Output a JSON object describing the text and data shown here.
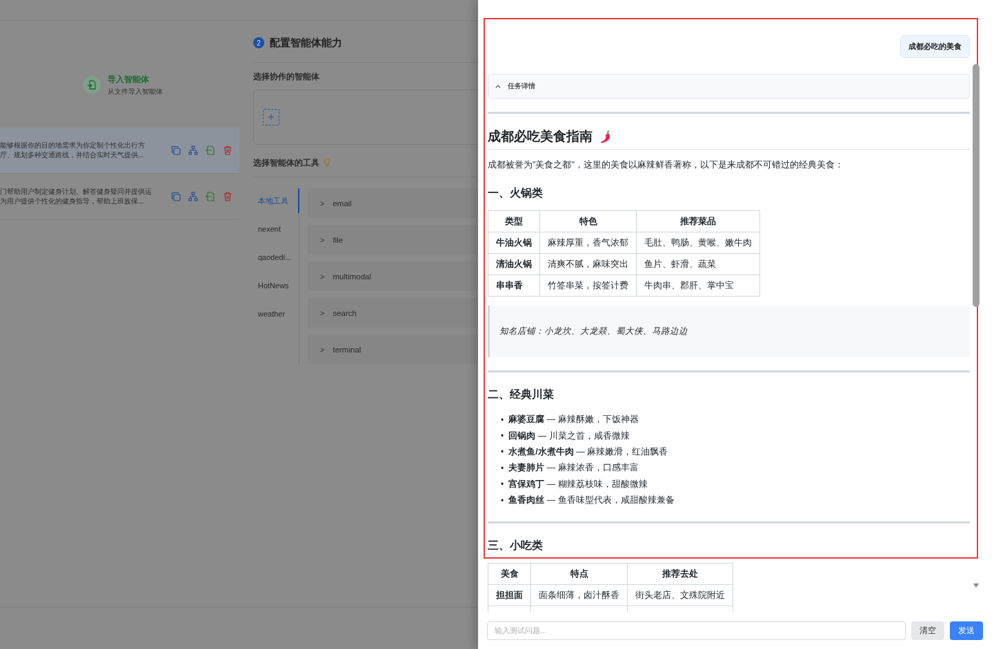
{
  "background_page": {
    "import_card": {
      "title": "导入智能体",
      "subtitle": "从文件导入智能体"
    },
    "agents": [
      {
        "selected": true,
        "lines": [
          "能够根据你的目的地需求为你定制个性化出行方",
          "厅、规划多种交通路线，并结合实时天气提供..."
        ]
      },
      {
        "selected": false,
        "lines": [
          "门帮助用户制定健身计划、解答健身疑问并提供运",
          "为用户提供个性化的健身指导，帮助上班族保..."
        ]
      }
    ],
    "step": {
      "number": "2",
      "title": "配置智能体能力"
    },
    "collab_label": "选择协作的智能体",
    "add_button": "+",
    "tools_label": "选择智能体的工具",
    "tool_sources": [
      {
        "label": "本地工具",
        "selected": true
      },
      {
        "label": "nexent",
        "selected": false
      },
      {
        "label": "qaodedi...",
        "selected": false
      },
      {
        "label": "HotNews",
        "selected": false
      },
      {
        "label": "weather",
        "selected": false
      }
    ],
    "tools": [
      {
        "name": "email",
        "expander": ">"
      },
      {
        "name": "file",
        "expander": ">"
      },
      {
        "name": "multimodal",
        "expander": ">"
      },
      {
        "name": "search",
        "expander": ">"
      },
      {
        "name": "terminal",
        "expander": ">"
      }
    ]
  },
  "drawer": {
    "user_message": "成都必吃的美食",
    "task_details": {
      "label": "任务详情"
    },
    "answer": [
      {
        "kind": "hr"
      },
      {
        "kind": "h1",
        "text": "成都必吃美食指南"
      },
      {
        "kind": "p",
        "text": "成都被誉为\"美食之都\"，这里的美食以麻辣鲜香著称，以下是来成都不可错过的经典美食："
      },
      {
        "kind": "h2",
        "text": "一、火锅类"
      },
      {
        "kind": "table",
        "columns": [
          "类型",
          "特色",
          "推荐菜品"
        ],
        "rows": [
          [
            "牛油火锅",
            "麻辣厚重，香气浓郁",
            "毛肚、鸭肠、黄喉、嫩牛肉"
          ],
          [
            "清油火锅",
            "清爽不腻，麻味突出",
            "鱼片、虾滑、蔬菜"
          ],
          [
            "串串香",
            "竹签串菜，按签计费",
            "牛肉串、郡肝、掌中宝"
          ]
        ]
      },
      {
        "kind": "quote",
        "text": "知名店铺：小龙坎、大龙燚、蜀大侠、马路边边"
      },
      {
        "kind": "hr"
      },
      {
        "kind": "h2",
        "text": "二、经典川菜"
      },
      {
        "kind": "list",
        "marker": "•",
        "items": [
          "**麻婆豆腐** — 麻辣酥嫩，下饭神器",
          "**回锅肉** — 川菜之首，咸香微辣",
          "**水煮鱼/水煮牛肉** — 麻辣嫩滑，红油飘香",
          "**夫妻肺片** — 麻辣浓香，口感丰富",
          "**宫保鸡丁** — 糊辣荔枝味，甜酸微辣",
          "**鱼香肉丝** — 鱼香味型代表，咸甜酸辣兼备"
        ]
      },
      {
        "kind": "hr"
      },
      {
        "kind": "h2",
        "text": "三、小吃类"
      },
      {
        "kind": "table",
        "columns": [
          "美食",
          "特点",
          "推荐去处"
        ],
        "rows": [
          [
            "担担面",
            "面条细薄，卤汁酥香",
            "街头老店、文殊院附近"
          ]
        ],
        "cut_row": true
      }
    ],
    "input": {
      "placeholder": "输入测试问题..."
    },
    "buttons": [
      {
        "label": "清空",
        "kind": "secondary"
      },
      {
        "label": "发送",
        "kind": "primary"
      }
    ]
  }
}
